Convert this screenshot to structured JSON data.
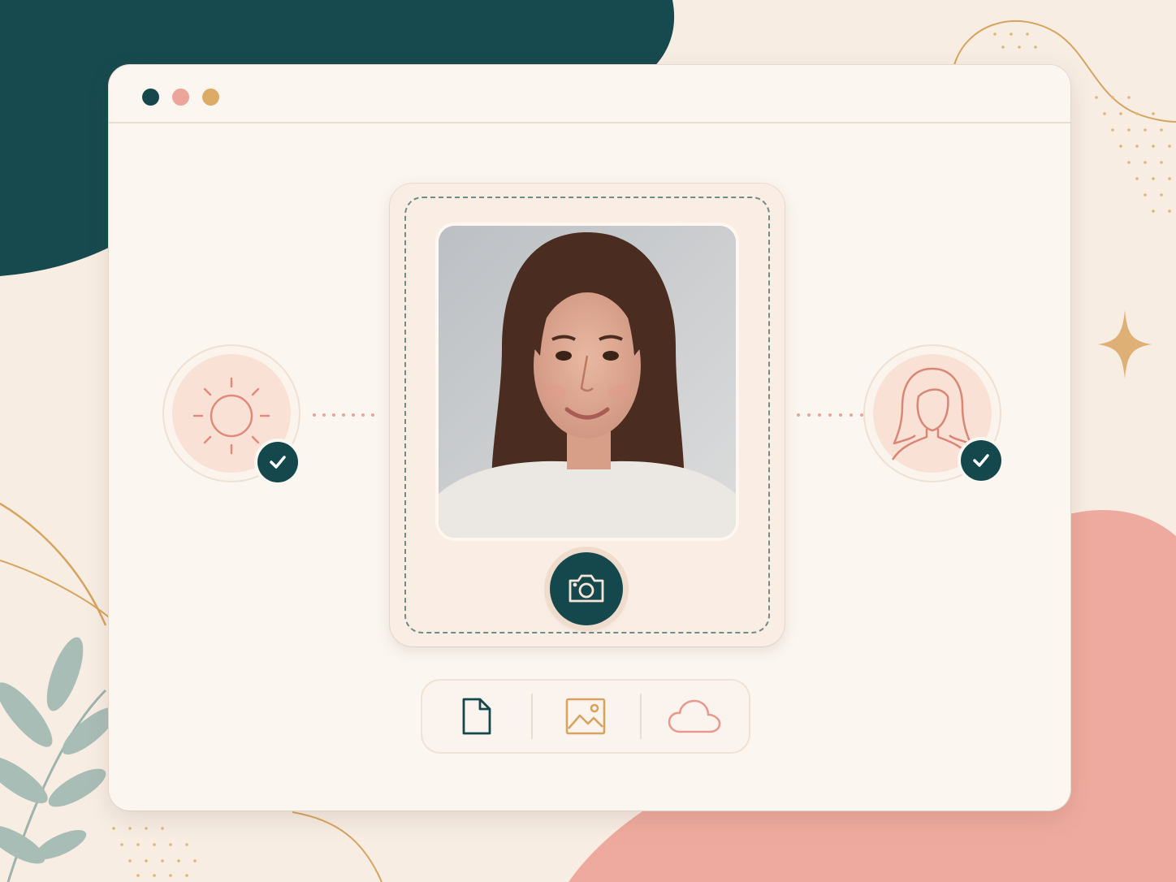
{
  "colors": {
    "teal": "#15484d",
    "pink": "#e8998e",
    "gold": "#d6a45f",
    "cream": "#fbf6f0",
    "blush": "#fae1d6"
  },
  "window": {
    "controls": [
      {
        "name": "close",
        "color": "#15484d"
      },
      {
        "name": "minimize",
        "color": "#eba59b"
      },
      {
        "name": "maximize",
        "color": "#dcab66"
      }
    ]
  },
  "left_check": {
    "icon": "sun-icon",
    "status": "check-icon"
  },
  "right_check": {
    "icon": "person-silhouette-icon",
    "status": "check-icon"
  },
  "upload_card": {
    "photo": "portrait-photo",
    "action_icon": "camera-icon"
  },
  "toolbar": {
    "options": [
      {
        "icon": "file-icon",
        "color": "#15484d"
      },
      {
        "icon": "image-icon",
        "color": "#d6a45f"
      },
      {
        "icon": "cloud-icon",
        "color": "#e8998e"
      }
    ]
  }
}
